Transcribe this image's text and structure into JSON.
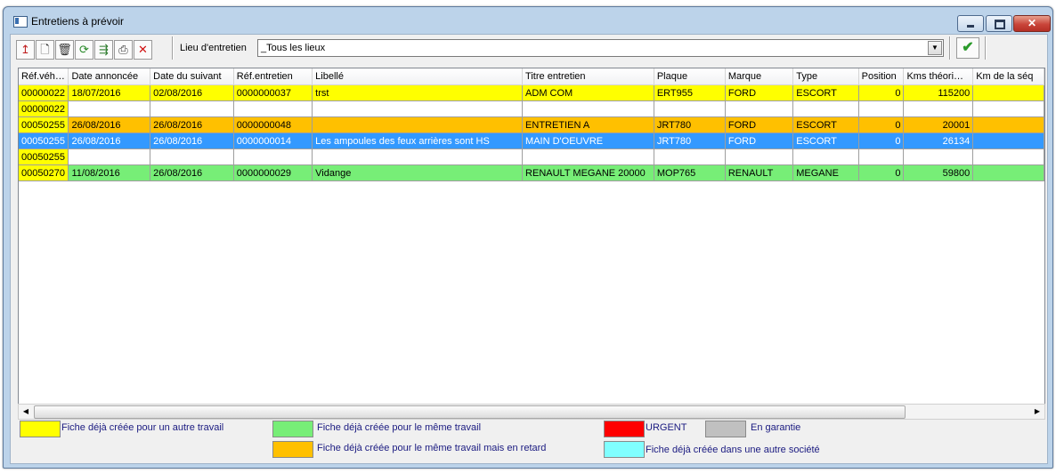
{
  "window": {
    "title": "Entretiens à prévoir",
    "minimize": "",
    "maximize": "",
    "close": "✕"
  },
  "toolbar": {
    "buttons": [
      {
        "name": "import-icon",
        "glyph": "↥",
        "color": "#c02020"
      },
      {
        "name": "new-document-icon",
        "glyph": "🗋",
        "color": "#333333"
      },
      {
        "name": "trash-icon",
        "glyph": "🗑",
        "color": "#333333"
      },
      {
        "name": "refresh-icon",
        "glyph": "⟳",
        "color": "#2a8a2a"
      },
      {
        "name": "transfer-icon",
        "glyph": "⇶",
        "color": "#2a7a2a"
      },
      {
        "name": "printer-icon",
        "glyph": "⎙",
        "color": "#333333"
      },
      {
        "name": "delete-icon",
        "glyph": "✕",
        "color": "#d01010"
      }
    ],
    "lieu_label": "Lieu d'entretien",
    "lieu_value": "_Tous les lieux",
    "combo_arrow": "▼",
    "ok_glyph": "✔"
  },
  "table": {
    "columns": [
      "Réf.véh…",
      "Date annoncée",
      "Date du suivant",
      "Réf.entretien",
      "Libellé",
      "Titre entretien",
      "Plaque",
      "Marque",
      "Type",
      "Position",
      "Kms théori…",
      "Km de la séq"
    ],
    "rows": [
      {
        "color": "#ffff00",
        "first_color": "#ffff00",
        "selected": false,
        "cells": [
          "00000022",
          "18/07/2016",
          "02/08/2016",
          "0000000037",
          "trst",
          "ADM COM",
          "ERT955",
          "FORD",
          "ESCORT",
          "0",
          "115200",
          ""
        ]
      },
      {
        "color": "#ffffff",
        "first_color": "#ffff00",
        "selected": false,
        "cells": [
          "00000022",
          "",
          "",
          "",
          "",
          "",
          "",
          "",
          "",
          "",
          "",
          ""
        ]
      },
      {
        "color": "#ffc000",
        "first_color": "#ffff00",
        "selected": false,
        "cells": [
          "00050255",
          "26/08/2016",
          "26/08/2016",
          "0000000048",
          "",
          "ENTRETIEN A",
          "JRT780",
          "FORD",
          "ESCORT",
          "0",
          "20001",
          ""
        ]
      },
      {
        "color": "#3399ff",
        "first_color": "#3399ff",
        "selected": true,
        "cells": [
          "00050255",
          "26/08/2016",
          "26/08/2016",
          "0000000014",
          "Les ampoules des feux arrières sont HS",
          "MAIN D'OEUVRE",
          "JRT780",
          "FORD",
          "ESCORT",
          "0",
          "26134",
          ""
        ]
      },
      {
        "color": "#ffffff",
        "first_color": "#ffff00",
        "selected": false,
        "cells": [
          "00050255",
          "",
          "",
          "",
          "",
          "",
          "",
          "",
          "",
          "",
          "",
          ""
        ]
      },
      {
        "color": "#77ee77",
        "first_color": "#ffff00",
        "selected": false,
        "cells": [
          "00050270",
          "11/08/2016",
          "26/08/2016",
          "0000000029",
          "Vidange",
          "RENAULT MEGANE 20000",
          "MOP765",
          "RENAULT",
          "MEGANE",
          "0",
          "59800",
          ""
        ]
      }
    ]
  },
  "scrollbar": {
    "left_arrow": "◀",
    "right_arrow": "▶"
  },
  "legend": [
    {
      "name": "legend-autre-travail",
      "color": "#ffff00",
      "label": "Fiche déjà créée pour un autre travail"
    },
    {
      "name": "legend-meme-travail",
      "color": "#77ee77",
      "label": "Fiche déjà créée pour le même travail"
    },
    {
      "name": "legend-meme-travail-retard",
      "color": "#ffc000",
      "label": "Fiche déjà créée pour le même travail mais en retard"
    },
    {
      "name": "legend-urgent",
      "color": "#ff0000",
      "label": "URGENT"
    },
    {
      "name": "legend-garantie",
      "color": "#c0c0c0",
      "label": "En garantie"
    },
    {
      "name": "legend-autre-societe",
      "color": "#80ffff",
      "label": "Fiche déjà créée dans une autre société"
    }
  ]
}
